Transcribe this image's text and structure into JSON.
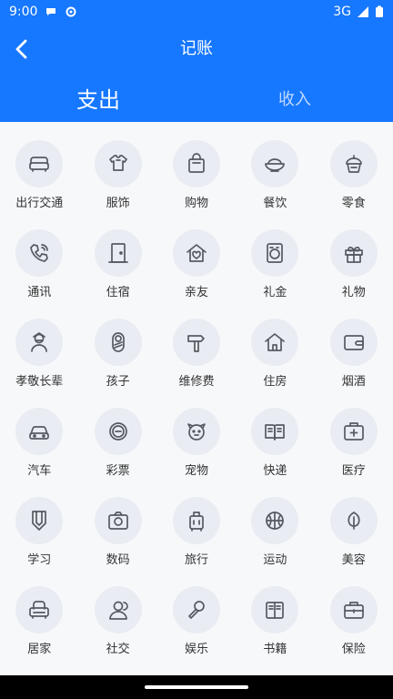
{
  "status": {
    "time": "9:00",
    "network": "3G"
  },
  "header": {
    "title": "记账"
  },
  "tabs": [
    {
      "label": "支出",
      "active": true
    },
    {
      "label": "收入",
      "active": false
    }
  ],
  "categories": [
    {
      "label": "出行交通",
      "icon": "sofa-icon"
    },
    {
      "label": "服饰",
      "icon": "shirt-icon"
    },
    {
      "label": "购物",
      "icon": "bag-icon"
    },
    {
      "label": "餐饮",
      "icon": "bowl-icon"
    },
    {
      "label": "零食",
      "icon": "cupcake-icon"
    },
    {
      "label": "通讯",
      "icon": "phone-icon"
    },
    {
      "label": "住宿",
      "icon": "door-icon"
    },
    {
      "label": "亲友",
      "icon": "home-heart-icon"
    },
    {
      "label": "礼金",
      "icon": "washer-icon"
    },
    {
      "label": "礼物",
      "icon": "gift-icon"
    },
    {
      "label": "孝敬长辈",
      "icon": "elder-icon"
    },
    {
      "label": "孩子",
      "icon": "baby-icon"
    },
    {
      "label": "维修费",
      "icon": "hammer-icon"
    },
    {
      "label": "住房",
      "icon": "house-icon"
    },
    {
      "label": "烟酒",
      "icon": "wallet-icon"
    },
    {
      "label": "汽车",
      "icon": "car-icon"
    },
    {
      "label": "彩票",
      "icon": "lottery-icon"
    },
    {
      "label": "宠物",
      "icon": "pet-icon"
    },
    {
      "label": "快递",
      "icon": "book-open-icon"
    },
    {
      "label": "医疗",
      "icon": "medkit-icon"
    },
    {
      "label": "学习",
      "icon": "pencil-icon"
    },
    {
      "label": "数码",
      "icon": "camera-icon"
    },
    {
      "label": "旅行",
      "icon": "luggage-icon"
    },
    {
      "label": "运动",
      "icon": "basketball-icon"
    },
    {
      "label": "美容",
      "icon": "leaf-icon"
    },
    {
      "label": "居家",
      "icon": "armchair-icon"
    },
    {
      "label": "社交",
      "icon": "users-icon"
    },
    {
      "label": "娱乐",
      "icon": "microphone-icon"
    },
    {
      "label": "书籍",
      "icon": "book-icon"
    },
    {
      "label": "保险",
      "icon": "briefcase-icon"
    }
  ]
}
